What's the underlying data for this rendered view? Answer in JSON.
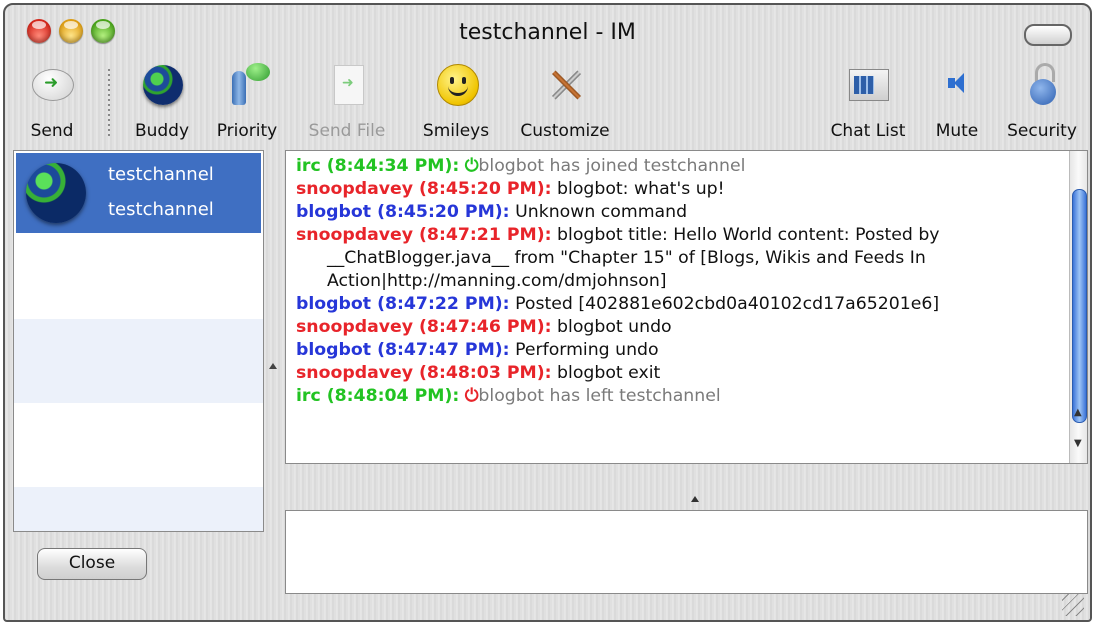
{
  "window": {
    "title": "testchannel - IM"
  },
  "toolbar": {
    "items": [
      {
        "label": "Send",
        "icon": "send-icon",
        "enabled": true
      },
      {
        "label": "Buddy",
        "icon": "globe-icon",
        "enabled": true
      },
      {
        "label": "Priority",
        "icon": "priority-icon",
        "enabled": true
      },
      {
        "label": "Send File",
        "icon": "send-file-icon",
        "enabled": false
      },
      {
        "label": "Smileys",
        "icon": "smiley-icon",
        "enabled": true
      },
      {
        "label": "Customize",
        "icon": "tools-icon",
        "enabled": true
      },
      {
        "label": "Chat List",
        "icon": "chat-list-icon",
        "enabled": true
      },
      {
        "label": "Mute",
        "icon": "speaker-icon",
        "enabled": true
      },
      {
        "label": "Security",
        "icon": "lock-icon",
        "enabled": true
      }
    ]
  },
  "buddies": {
    "selected": {
      "line1": "testchannel",
      "line2": "testchannel"
    }
  },
  "close_label": "Close",
  "colors": {
    "irc": "#22c322",
    "snoopdavey": "#e8242a",
    "blogbot": "#2636d8",
    "selection": "#3f6fc2"
  },
  "messages": [
    {
      "sender": "irc",
      "time": "(8:44:34 PM):",
      "text": "blogbot has joined testchannel",
      "system": true
    },
    {
      "sender": "snoopdavey",
      "time": "(8:45:20 PM):",
      "text": "blogbot: what's up!"
    },
    {
      "sender": "blogbot",
      "time": "(8:45:20 PM):",
      "text": "Unknown command"
    },
    {
      "sender": "snoopdavey",
      "time": "(8:47:21 PM):",
      "text": "blogbot title: Hello World content: Posted by __ChatBlogger.java__ from \"Chapter 15\" of [Blogs, Wikis and Feeds In Action|http://manning.com/dmjohnson]"
    },
    {
      "sender": "blogbot",
      "time": "(8:47:22 PM):",
      "text": "Posted [402881e602cbd0a40102cd17a65201e6]"
    },
    {
      "sender": "snoopdavey",
      "time": "(8:47:46 PM):",
      "text": "blogbot undo"
    },
    {
      "sender": "blogbot",
      "time": "(8:47:47 PM):",
      "text": "Performing undo"
    },
    {
      "sender": "snoopdavey",
      "time": "(8:48:03 PM):",
      "text": "blogbot exit"
    },
    {
      "sender": "irc",
      "time": "(8:48:04 PM):",
      "text": "blogbot has left testchannel",
      "system": true,
      "leave": true
    }
  ]
}
